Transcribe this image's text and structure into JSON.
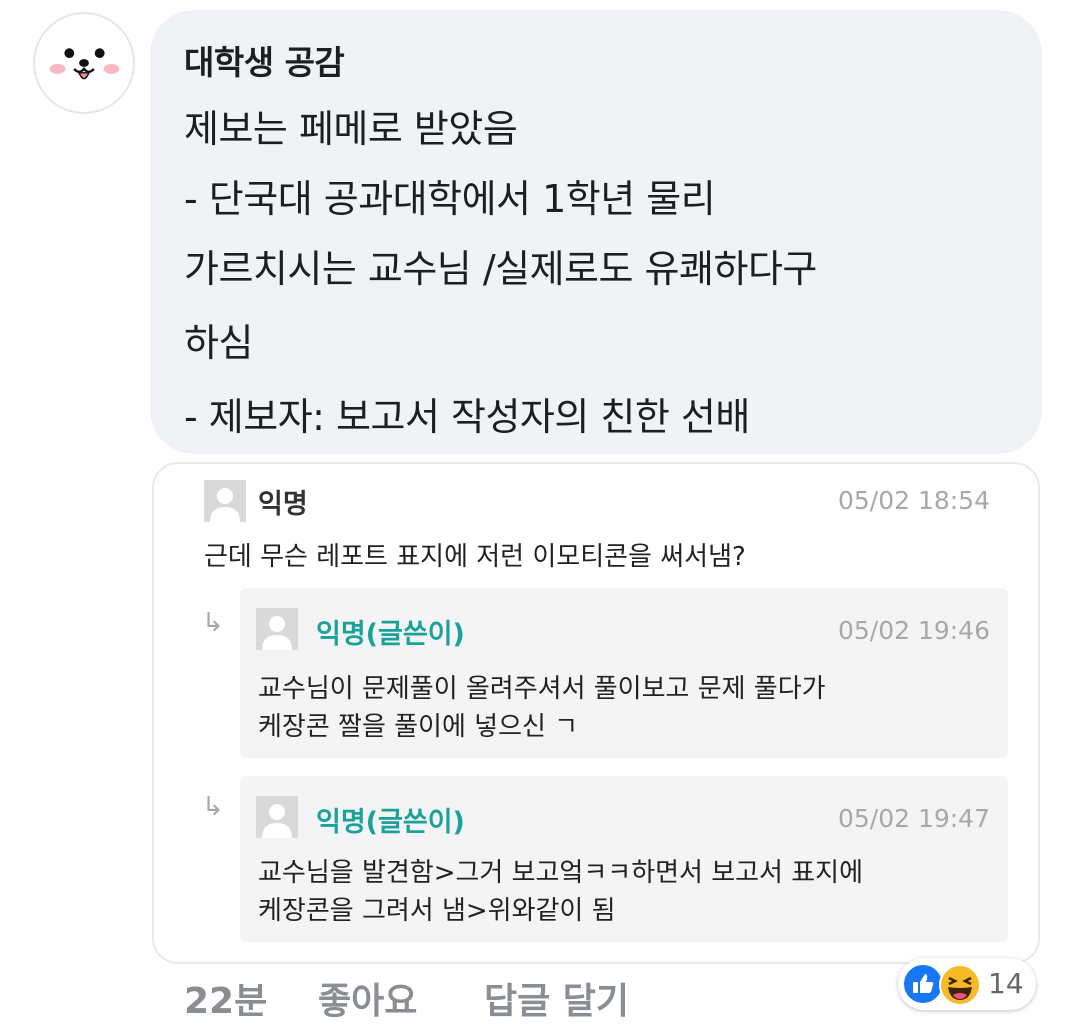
{
  "post": {
    "author": "대학생 공감",
    "lines": [
      "제보는 페메로 받았음",
      "- 단국대 공과대학에서 1학년 물리",
      "가르치시는 교수님 /실제로도 유쾌하다구",
      "하심",
      "- 제보자: 보고서 작성자의 친한 선배"
    ]
  },
  "comment": {
    "author": "익명",
    "time": "05/02 18:54",
    "text": "근데 무슨 레포트 표지에 저런 이모티콘을 써서냄?",
    "replies": [
      {
        "author": "익명(글쓴이)",
        "time": "05/02 19:46",
        "lines": [
          "교수님이 문제풀이 올려주셔서 풀이보고 문제 풀다가",
          "케장콘 짤을 풀이에 넣으신 ㄱ"
        ]
      },
      {
        "author": "익명(글쓴이)",
        "time": "05/02 19:47",
        "lines": [
          "교수님을 발견함>그거 보고엌ㅋㅋ하면서 보고서 표지에",
          "케장콘을 그려서 냄>위와같이 됨"
        ]
      }
    ]
  },
  "footer": {
    "time": "22분",
    "like": "좋아요",
    "reply": "답글 달기"
  },
  "reactions": {
    "icons": [
      "like-icon",
      "haha-icon"
    ],
    "count": "14"
  },
  "colors": {
    "bubble_bg": "#f0f2f5",
    "op_name": "#1aa29a",
    "like_blue": "#1877f2",
    "haha_yellow": "#f7b928"
  }
}
